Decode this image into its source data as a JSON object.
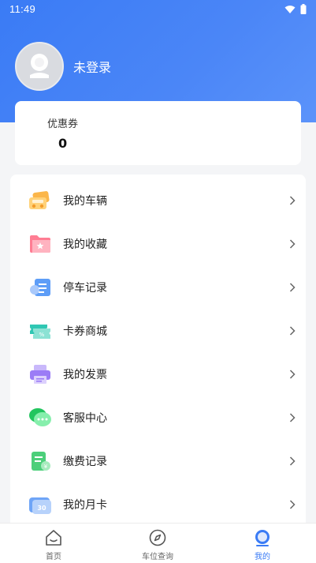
{
  "status_bar": {
    "time": "11:49",
    "icons": [
      "wifi-icon",
      "battery-icon"
    ]
  },
  "profile": {
    "name": "未登录",
    "avatar_icon": "user-avatar-icon"
  },
  "coupon": {
    "label": "优惠券",
    "value": "0"
  },
  "menu": [
    {
      "label": "我的车辆",
      "icon": "car-icon"
    },
    {
      "label": "我的收藏",
      "icon": "favorite-folder-icon"
    },
    {
      "label": "停车记录",
      "icon": "parking-record-icon"
    },
    {
      "label": "卡券商城",
      "icon": "coupon-mall-icon"
    },
    {
      "label": "我的发票",
      "icon": "invoice-printer-icon"
    },
    {
      "label": "客服中心",
      "icon": "customer-service-icon"
    },
    {
      "label": "缴费记录",
      "icon": "payment-record-icon"
    },
    {
      "label": "我的月卡",
      "icon": "monthly-card-icon"
    }
  ],
  "tabbar": [
    {
      "label": "首页",
      "icon": "home-icon",
      "active": false
    },
    {
      "label": "车位查询",
      "icon": "compass-icon",
      "active": false
    },
    {
      "label": "我的",
      "icon": "profile-icon",
      "active": true
    }
  ],
  "colors": {
    "primary": "#3a7bf5",
    "background": "#f4f5f7"
  }
}
